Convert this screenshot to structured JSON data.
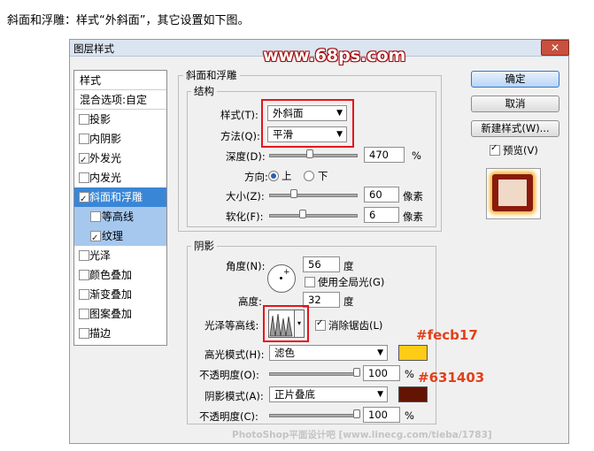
{
  "instruction": "斜面和浮雕：样式“外斜面”，其它设置如下图。",
  "watermark": "www.68ps.com",
  "footer_watermark": "PhotoShop平面设计吧 [www.linecg.com/tieba/1783]",
  "dialog": {
    "title": "图层样式",
    "close": "✕"
  },
  "style_list": {
    "header": "样式",
    "blend_options": "混合选项:自定",
    "items": [
      {
        "label": "投影",
        "checked": false
      },
      {
        "label": "内阴影",
        "checked": false
      },
      {
        "label": "外发光",
        "checked": true
      },
      {
        "label": "内发光",
        "checked": false
      },
      {
        "label": "斜面和浮雕",
        "checked": true,
        "selected": true
      },
      {
        "label": "等高线",
        "checked": false,
        "sub": true
      },
      {
        "label": "纹理",
        "checked": true,
        "sub": true
      },
      {
        "label": "光泽",
        "checked": false
      },
      {
        "label": "颜色叠加",
        "checked": false
      },
      {
        "label": "渐变叠加",
        "checked": false
      },
      {
        "label": "图案叠加",
        "checked": false
      },
      {
        "label": "描边",
        "checked": false
      }
    ]
  },
  "bevel": {
    "group_title": "斜面和浮雕",
    "structure_title": "结构",
    "style_label": "样式(T):",
    "style_value": "外斜面",
    "method_label": "方法(Q):",
    "method_value": "平滑",
    "depth_label": "深度(D):",
    "depth_value": "470",
    "depth_unit": "%",
    "direction_label": "方向:",
    "direction_up": "上",
    "direction_down": "下",
    "size_label": "大小(Z):",
    "size_value": "60",
    "size_unit": "像素",
    "soften_label": "软化(F):",
    "soften_value": "6",
    "soften_unit": "像素"
  },
  "shading": {
    "title": "阴影",
    "angle_label": "角度(N):",
    "angle_value": "56",
    "angle_unit": "度",
    "global_light_label": "使用全局光(G)",
    "altitude_label": "高度:",
    "altitude_value": "32",
    "altitude_unit": "度",
    "gloss_label": "光泽等高线:",
    "antialias_label": "消除锯齿(L)",
    "highlight_mode_label": "高光模式(H):",
    "highlight_mode_value": "滤色",
    "highlight_color": "#fecb17",
    "highlight_opacity_label": "不透明度(O):",
    "highlight_opacity_value": "100",
    "percent": "%",
    "shadow_mode_label": "阴影模式(A):",
    "shadow_mode_value": "正片叠底",
    "shadow_color": "#631403",
    "shadow_opacity_label": "不透明度(C):",
    "shadow_opacity_value": "100"
  },
  "buttons": {
    "ok": "确定",
    "cancel": "取消",
    "new_style": "新建样式(W)...",
    "preview": "预览(V)"
  },
  "annotations": {
    "highlight_hex": "#fecb17",
    "shadow_hex": "#631403"
  }
}
